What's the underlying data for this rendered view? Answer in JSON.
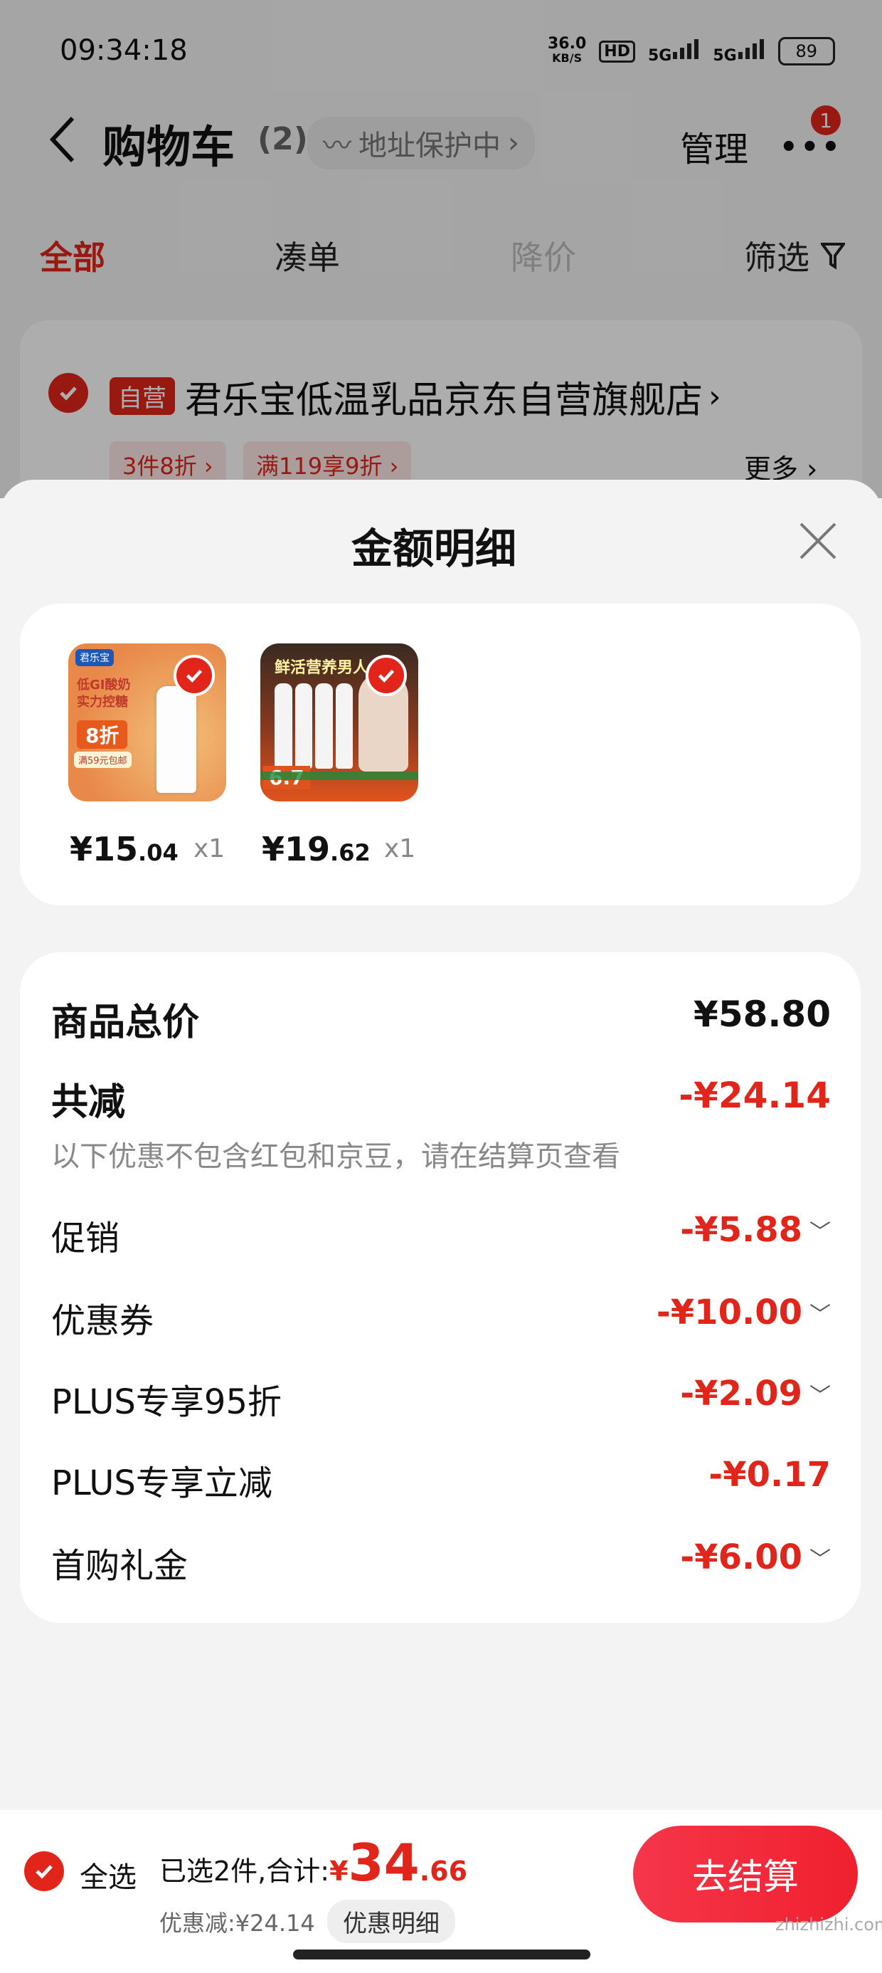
{
  "status_bar": {
    "time": "09:34:18",
    "net_speed": "36.0",
    "net_unit": "KB/S",
    "hd": "HD",
    "sig1": "5G",
    "sig2": "5G",
    "battery": "89"
  },
  "header": {
    "title": "购物车",
    "count": "(2)",
    "address_protect": "地址保护中",
    "manage": "管理",
    "more_badge": "1"
  },
  "tabs": [
    {
      "label": "全部"
    },
    {
      "label": "凑单"
    },
    {
      "label": "降价"
    },
    {
      "label": "筛选"
    }
  ],
  "store": {
    "self_badge": "自营",
    "name": "君乐宝低温乳品京东自营旗舰店",
    "promos": [
      "3件8折",
      "满119享9折"
    ],
    "more": "更多"
  },
  "sheet": {
    "title": "金额明细",
    "items": [
      {
        "price_int": "¥15",
        "price_dec": ".04",
        "qty": "x1",
        "thumb_texts": [
          "君乐宝",
          "低GI酸奶",
          "实力控糖",
          "8折",
          "满59元包邮"
        ]
      },
      {
        "price_int": "¥19",
        "price_dec": ".62",
        "qty": "x1",
        "thumb_texts": [
          "鲜活营养男人",
          "6.7"
        ]
      }
    ],
    "summary": {
      "total_label": "商品总价",
      "total_value": "¥58.80",
      "reduce_label": "共减",
      "reduce_value": "-¥24.14",
      "note": "以下优惠不包含红包和京豆，请在结算页查看",
      "rows": [
        {
          "label": "促销",
          "value": "-¥5.88",
          "chevron": true
        },
        {
          "label": "优惠券",
          "value": "-¥10.00",
          "chevron": true
        },
        {
          "label": "PLUS专享95折",
          "value": "-¥2.09",
          "chevron": true
        },
        {
          "label": "PLUS专享立减",
          "value": "-¥0.17",
          "chevron": false
        },
        {
          "label": "首购礼金",
          "value": "-¥6.00",
          "chevron": true
        }
      ]
    }
  },
  "bottom_bar": {
    "select_all": "全选",
    "selected_text": "已选2件,合计:",
    "currency": "¥",
    "total_int": "34",
    "total_dec": ".66",
    "discount_text": "优惠减:¥24.14",
    "detail_button": "优惠明细",
    "checkout": "去结算"
  },
  "watermark": "zhizhizhi.com",
  "colors": {
    "accent_red": "#e1251b",
    "checkout_gradient_start": "#f5364a",
    "checkout_gradient_end": "#f0202e"
  }
}
